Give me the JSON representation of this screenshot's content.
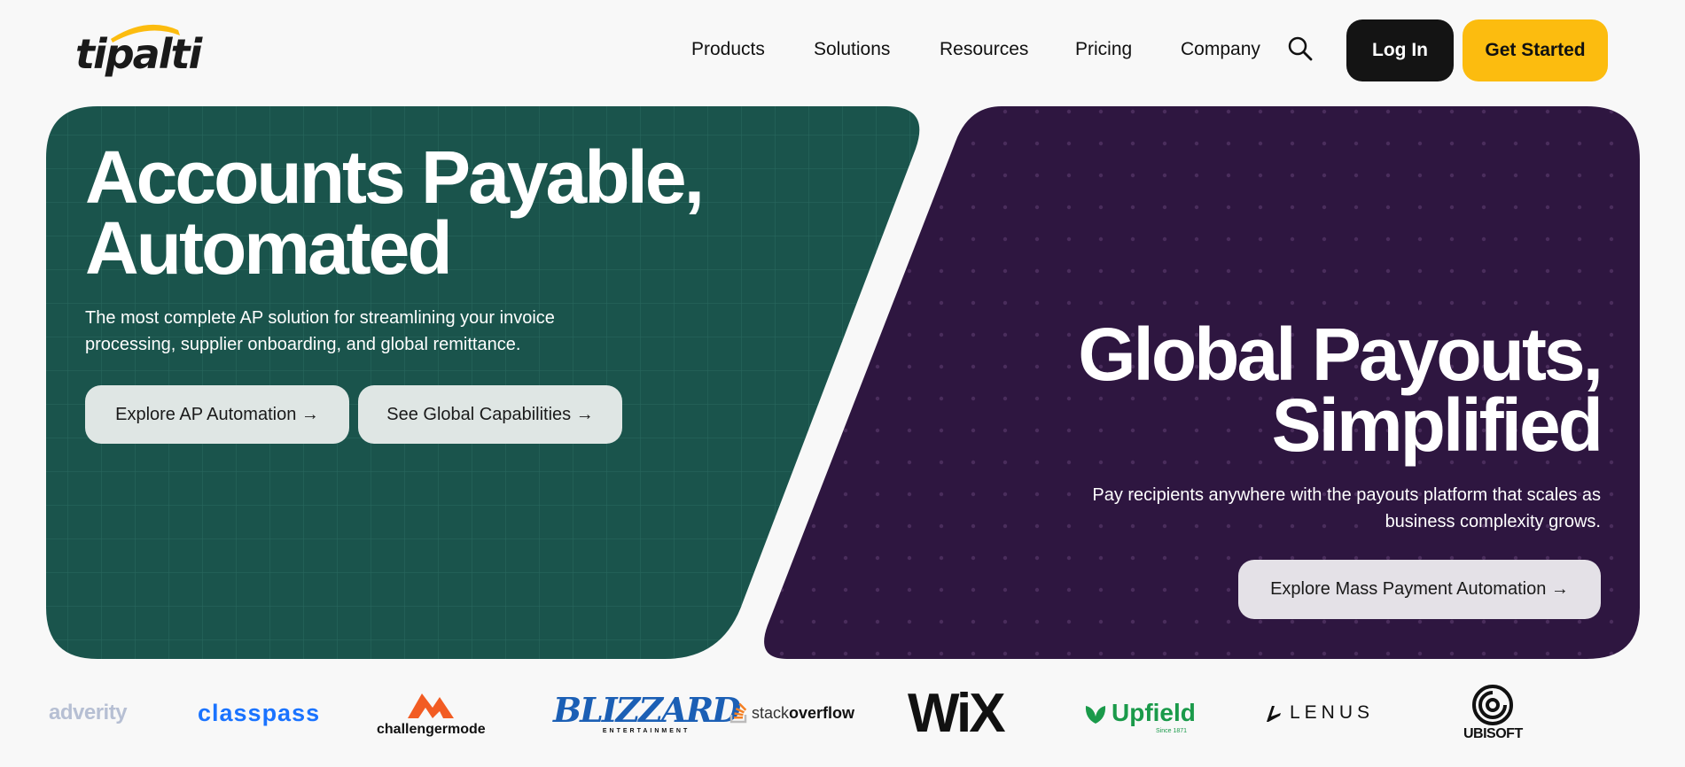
{
  "brand": {
    "logo_text": "tipalti",
    "accent_color": "#fcbc0f"
  },
  "nav": {
    "items": [
      {
        "label": "Products"
      },
      {
        "label": "Solutions"
      },
      {
        "label": "Resources"
      },
      {
        "label": "Pricing"
      },
      {
        "label": "Company"
      }
    ],
    "search_icon": "search-icon",
    "login_label": "Log In",
    "get_started_label": "Get Started"
  },
  "hero_left": {
    "title_line1": "Accounts Payable,",
    "title_line2": "Automated",
    "description": "The most complete AP solution for streamlining your invoice processing, supplier onboarding, and global remittance.",
    "buttons": [
      {
        "label": "Explore AP Automation →"
      },
      {
        "label": "See Global Capabilities →"
      }
    ],
    "bg_color": "#1a544c"
  },
  "hero_right": {
    "title_line1": "Global Payouts,",
    "title_line2": "Simplified",
    "description_line1": "Pay recipients anywhere with the payouts platform that scales as",
    "description_line2": "business complexity grows.",
    "button_label": "Explore Mass Payment Automation →",
    "bg_color": "#2e1640"
  },
  "customers": {
    "adverity": "adverity",
    "classpass": "classpass",
    "challengermode": "challengermode",
    "blizzard": "BLIZZARD",
    "blizzard_sub": "ENTERTAINMENT",
    "stackoverflow_a": "stack",
    "stackoverflow_b": "overflow",
    "wix": "WiX",
    "upfield": "Upfield",
    "upfield_since": "Since 1871",
    "lenus": "LENUS",
    "ubisoft": "UBISOFT"
  }
}
